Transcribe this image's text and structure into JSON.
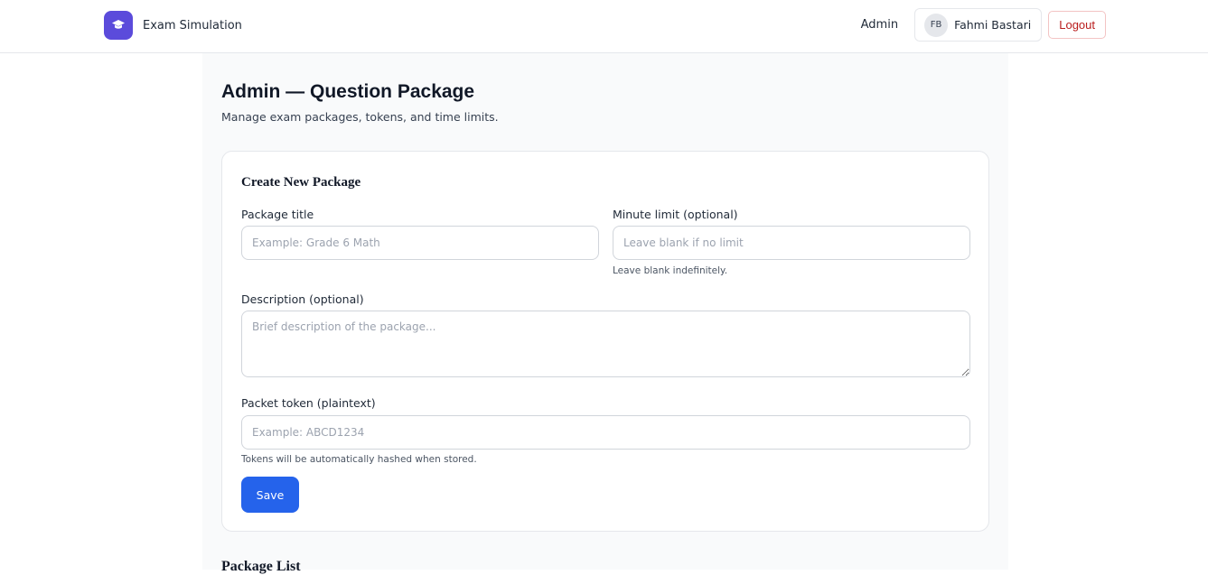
{
  "header": {
    "app_title": "Exam Simulation",
    "nav_admin": "Admin",
    "user_initials": "FB",
    "user_name": "Fahmi Bastari",
    "logout_label": "Logout",
    "logo_icon": "graduation-cap-icon"
  },
  "page": {
    "title": "Admin — Question Package",
    "subtitle": "Manage exam packages, tokens, and time limits."
  },
  "form": {
    "card_title": "Create New Package",
    "package_title_label": "Package title",
    "package_title_placeholder": "Example: Grade 6 Math",
    "minute_limit_label": "Minute limit (optional)",
    "minute_limit_placeholder": "Leave blank if no limit",
    "minute_limit_hint": "Leave blank indefinitely.",
    "description_label": "Description (optional)",
    "description_placeholder": "Brief description of the package...",
    "token_label": "Packet token (plaintext)",
    "token_placeholder": "Example: ABCD1234",
    "token_hint": "Tokens will be automatically hashed when stored.",
    "save_label": "Save"
  },
  "list": {
    "section_title": "Package List"
  },
  "colors": {
    "brand": "#5b4bdb",
    "primary": "#2563eb",
    "danger": "#b91c1c"
  }
}
